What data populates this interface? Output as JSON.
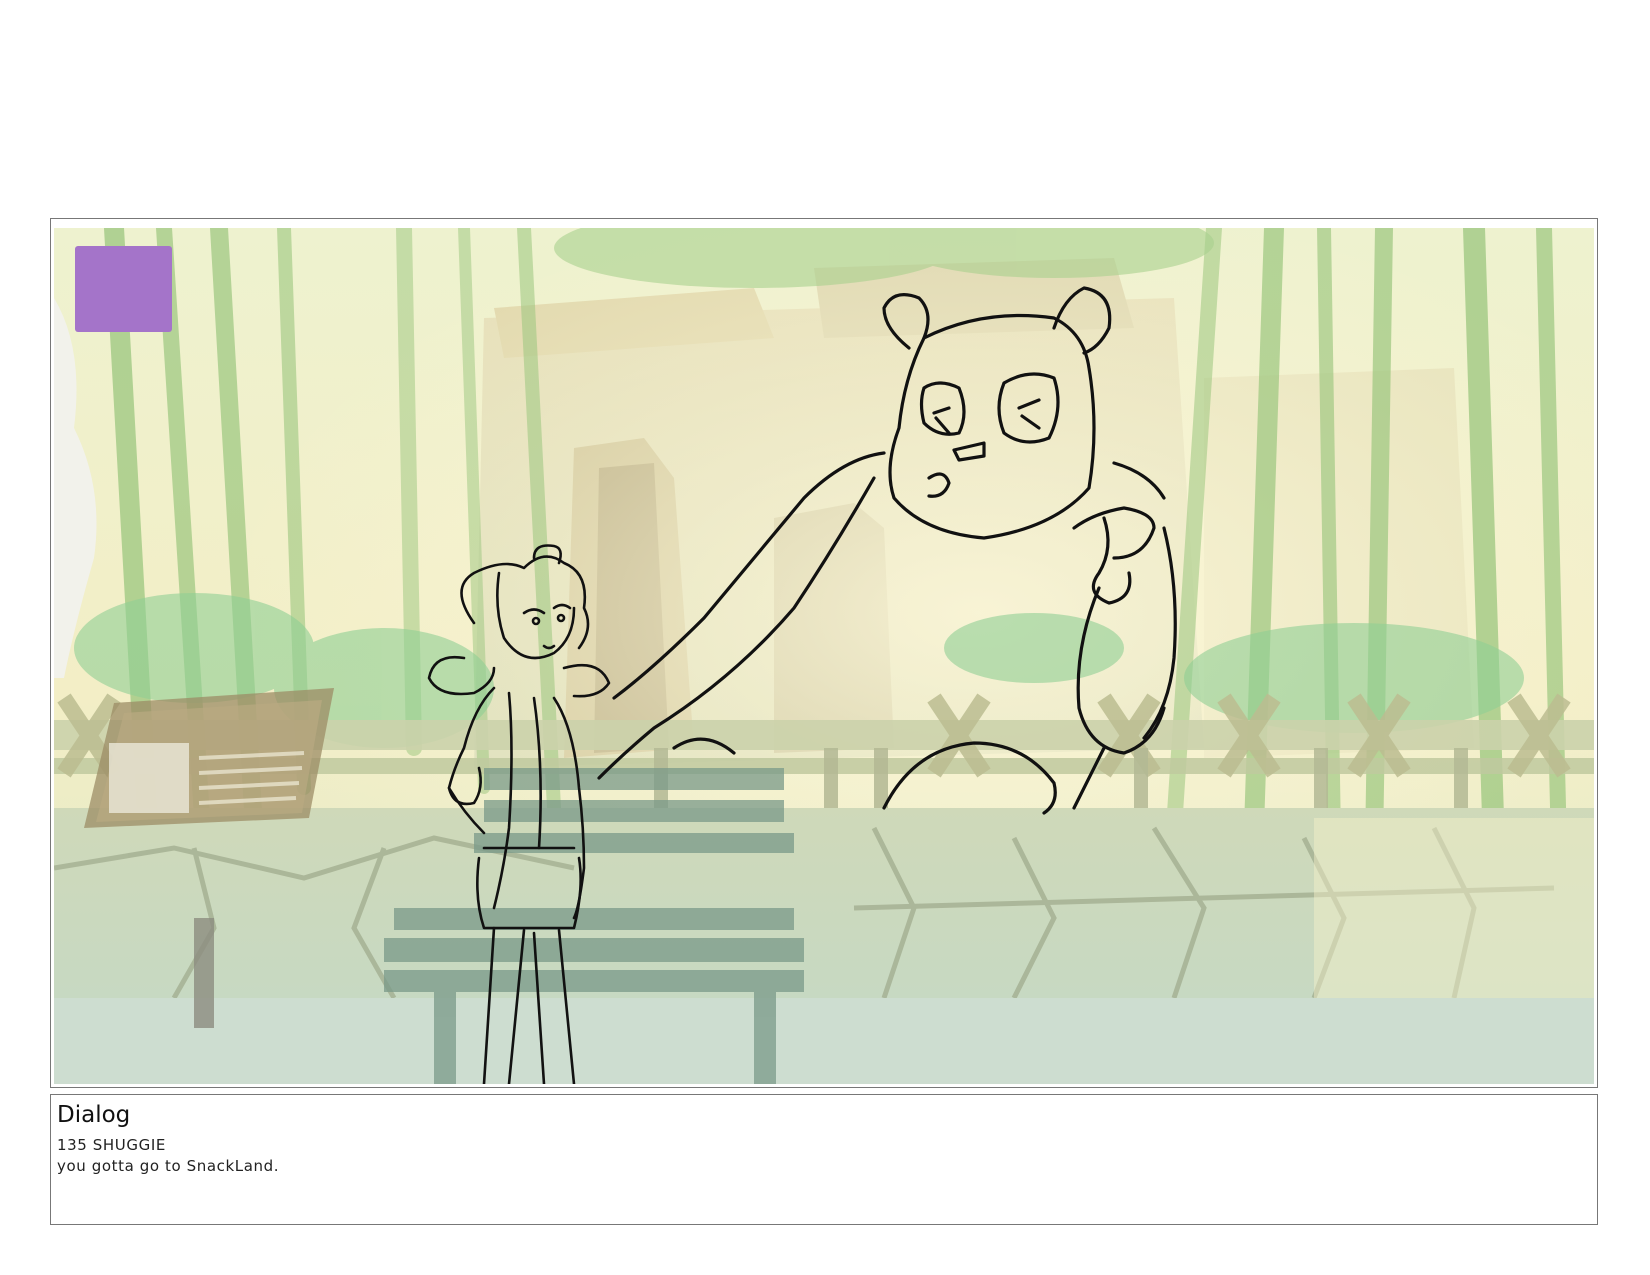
{
  "panel": {
    "marker_color": "#a474c9"
  },
  "dialog": {
    "heading": "Dialog",
    "speaker_line": "135 SHUGGIE",
    "text_line": "you gotta go to SnackLand."
  }
}
